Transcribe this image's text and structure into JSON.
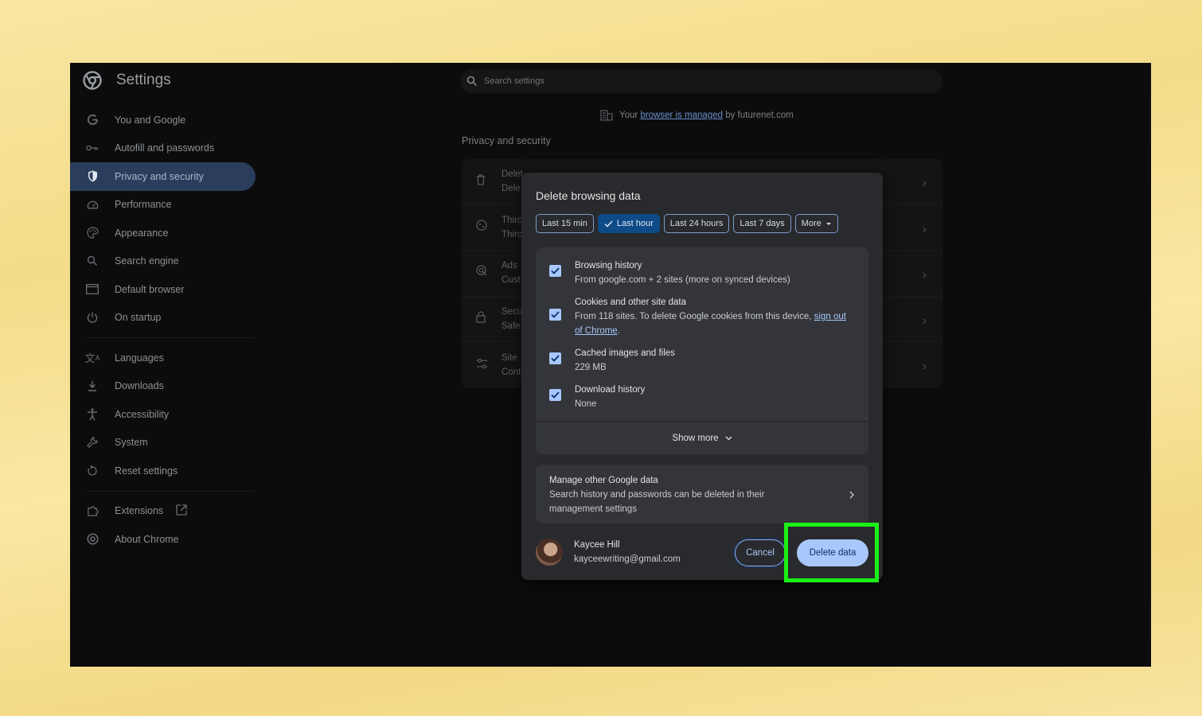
{
  "app": {
    "title": "Settings"
  },
  "search": {
    "placeholder": "Search settings"
  },
  "managed": {
    "prefix": "Your",
    "link": "browser is managed",
    "suffix": "by futurenet.com"
  },
  "sidebar": {
    "items": [
      {
        "label": "You and Google",
        "icon": "google-g-icon"
      },
      {
        "label": "Autofill and passwords",
        "icon": "key-icon"
      },
      {
        "label": "Privacy and security",
        "icon": "shield-icon",
        "active": true
      },
      {
        "label": "Performance",
        "icon": "speedometer-icon"
      },
      {
        "label": "Appearance",
        "icon": "palette-icon"
      },
      {
        "label": "Search engine",
        "icon": "search-icon"
      },
      {
        "label": "Default browser",
        "icon": "browser-window-icon"
      },
      {
        "label": "On startup",
        "icon": "power-icon"
      }
    ],
    "items2": [
      {
        "label": "Languages",
        "icon": "translate-icon"
      },
      {
        "label": "Downloads",
        "icon": "download-icon"
      },
      {
        "label": "Accessibility",
        "icon": "accessibility-icon"
      },
      {
        "label": "System",
        "icon": "wrench-icon"
      },
      {
        "label": "Reset settings",
        "icon": "reset-icon"
      }
    ],
    "items3": [
      {
        "label": "Extensions",
        "icon": "puzzle-icon"
      },
      {
        "label": "About Chrome",
        "icon": "chrome-icon"
      }
    ]
  },
  "main": {
    "section_title": "Privacy and security",
    "rows": [
      {
        "line1": "Delet",
        "line2": "Dele"
      },
      {
        "line1": "Thirc",
        "line2": "Thirc"
      },
      {
        "line1": "Ads",
        "line2": "Cust"
      },
      {
        "line1": "Secu",
        "line2": "Safe"
      },
      {
        "line1": "Site",
        "line2": "Cont"
      }
    ]
  },
  "dialog": {
    "title": "Delete browsing data",
    "time_ranges": [
      "Last 15 min",
      "Last hour",
      "Last 24 hours",
      "Last 7 days",
      "More"
    ],
    "selected_range": "Last hour",
    "options": [
      {
        "label": "Browsing history",
        "sub": "From google.com + 2 sites (more on synced devices)",
        "checked": true
      },
      {
        "label": "Cookies and other site data",
        "sub": "From 118 sites. To delete Google cookies from this device,",
        "sub_link": "sign out of Chrome",
        "sub_end": ".",
        "checked": true
      },
      {
        "label": "Cached images and files",
        "sub": "229 MB",
        "checked": true
      },
      {
        "label": "Download history",
        "sub": "None",
        "checked": true
      }
    ],
    "show_more": "Show more",
    "manage": {
      "label": "Manage other Google data",
      "sub": "Search history and passwords can be deleted in their management settings"
    },
    "account": {
      "name": "Kaycee Hill",
      "email": "kayceewriting@gmail.com"
    },
    "cancel_label": "Cancel",
    "delete_label": "Delete data"
  },
  "colors": {
    "highlight": "#19f016",
    "accent": "#a8c7fa",
    "active_nav": "#2a3d5c"
  }
}
